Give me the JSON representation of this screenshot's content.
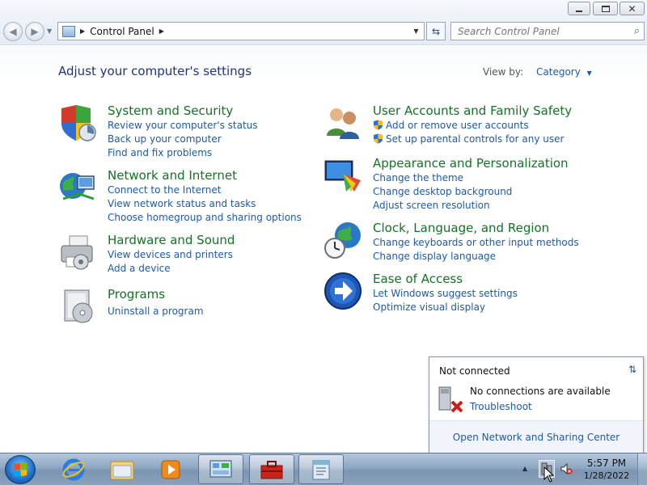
{
  "address": {
    "crumbs": [
      "Control Panel"
    ],
    "search_placeholder": "Search Control Panel"
  },
  "header": {
    "title": "Adjust your computer's settings",
    "view_by_label": "View by:",
    "view_by_value": "Category"
  },
  "categories": [
    {
      "title": "System and Security",
      "links": [
        "Review your computer's status",
        "Back up your computer",
        "Find and fix problems"
      ],
      "icon": "shield-icon"
    },
    {
      "title": "Network and Internet",
      "links": [
        "Connect to the Internet",
        "View network status and tasks",
        "Choose homegroup and sharing options"
      ],
      "icon": "globe-network-icon"
    },
    {
      "title": "Hardware and Sound",
      "links": [
        "View devices and printers",
        "Add a device"
      ],
      "icon": "printer-icon"
    },
    {
      "title": "Programs",
      "links": [
        "Uninstall a program"
      ],
      "icon": "programs-icon"
    },
    {
      "title": "User Accounts and Family Safety",
      "links": [
        "Add or remove user accounts",
        "Set up parental controls for any user"
      ],
      "icon": "users-icon"
    },
    {
      "title": "Appearance and Personalization",
      "links": [
        "Change the theme",
        "Change desktop background",
        "Adjust screen resolution"
      ],
      "icon": "monitor-palette-icon"
    },
    {
      "title": "Clock, Language, and Region",
      "links": [
        "Change keyboards or other input methods",
        "Change display language"
      ],
      "icon": "clock-globe-icon"
    },
    {
      "title": "Ease of Access",
      "links": [
        "Let Windows suggest settings",
        "Optimize visual display"
      ],
      "icon": "ease-of-access-icon"
    }
  ],
  "network_popup": {
    "status": "Not connected",
    "message": "No connections are available",
    "troubleshoot": "Troubleshoot",
    "footer": "Open Network and Sharing Center"
  },
  "taskbar": {
    "time": "5:57 PM",
    "date": "1/28/2022",
    "pinned": [
      "internet-explorer-icon",
      "windows-explorer-icon",
      "media-player-icon",
      "control-panel-icon",
      "toolbox-icon",
      "notepad-icon"
    ]
  },
  "colors": {
    "category_title": "#127325",
    "link": "#1e5aa8",
    "header_title": "#1e3287"
  }
}
